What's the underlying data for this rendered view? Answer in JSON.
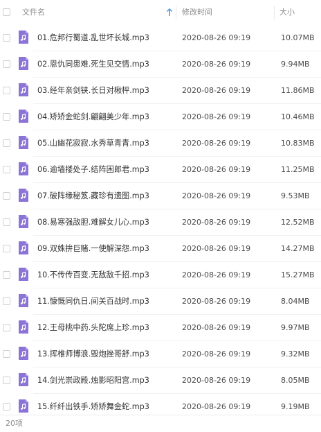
{
  "header": {
    "name_label": "文件名",
    "modified_label": "修改时间",
    "size_label": "大小"
  },
  "colors": {
    "file_icon": "#8c74d6",
    "sort_arrow": "#3b8eea"
  },
  "files": [
    {
      "name": "01.危邦行蜀道.乱世坏长城.mp3",
      "modified": "2020-08-26 09:19",
      "size": "10.07MB",
      "icon": "audio-file-icon"
    },
    {
      "name": "02.恩仇同患难.死生见交情.mp3",
      "modified": "2020-08-26 09:19",
      "size": "9.94MB",
      "icon": "audio-file-icon"
    },
    {
      "name": "03.经年亲剑铗.长日对楸枰.mp3",
      "modified": "2020-08-26 09:19",
      "size": "11.86MB",
      "icon": "audio-file-icon"
    },
    {
      "name": "04.矫矫金蛇剑.翩翩美少年.mp3",
      "modified": "2020-08-26 09:19",
      "size": "10.46MB",
      "icon": "audio-file-icon"
    },
    {
      "name": "05.山幽花寂寂.水秀草青青.mp3",
      "modified": "2020-08-26 09:19",
      "size": "10.83MB",
      "icon": "audio-file-icon"
    },
    {
      "name": "06.逾墙搂处子.结阵困郎君.mp3",
      "modified": "2020-08-26 09:19",
      "size": "11.25MB",
      "icon": "audio-file-icon"
    },
    {
      "name": "07.破阵缘秘笈.藏珍有遗图.mp3",
      "modified": "2020-08-26 09:19",
      "size": "9.53MB",
      "icon": "audio-file-icon"
    },
    {
      "name": "08.易寒强敌胆.难解女儿心.mp3",
      "modified": "2020-08-26 09:19",
      "size": "12.52MB",
      "icon": "audio-file-icon"
    },
    {
      "name": "09.双姝拚巨赌.一使解深怨.mp3",
      "modified": "2020-08-26 09:19",
      "size": "14.27MB",
      "icon": "audio-file-icon"
    },
    {
      "name": "10.不传传百变.无敌敌千招.mp3",
      "modified": "2020-08-26 09:19",
      "size": "15.27MB",
      "icon": "audio-file-icon"
    },
    {
      "name": "11.慷慨同仇日.间关百战时.mp3",
      "modified": "2020-08-26 09:19",
      "size": "8.04MB",
      "icon": "audio-file-icon"
    },
    {
      "name": "12.王母桃中药.头陀席上珍.mp3",
      "modified": "2020-08-26 09:19",
      "size": "9.97MB",
      "icon": "audio-file-icon"
    },
    {
      "name": "13.挥椎师博浪.毁炮挫哥舒.mp3",
      "modified": "2020-08-26 09:19",
      "size": "9.32MB",
      "icon": "audio-file-icon"
    },
    {
      "name": "14.剑光崇政殿.烛影昭阳宫.mp3",
      "modified": "2020-08-26 09:19",
      "size": "8.05MB",
      "icon": "audio-file-icon"
    },
    {
      "name": "15.纤纤出铁手.矫矫舞金蛇.mp3",
      "modified": "2020-08-26 09:19",
      "size": "9.19MB",
      "icon": "audio-file-icon"
    }
  ],
  "footer": {
    "count_label": "20项"
  }
}
